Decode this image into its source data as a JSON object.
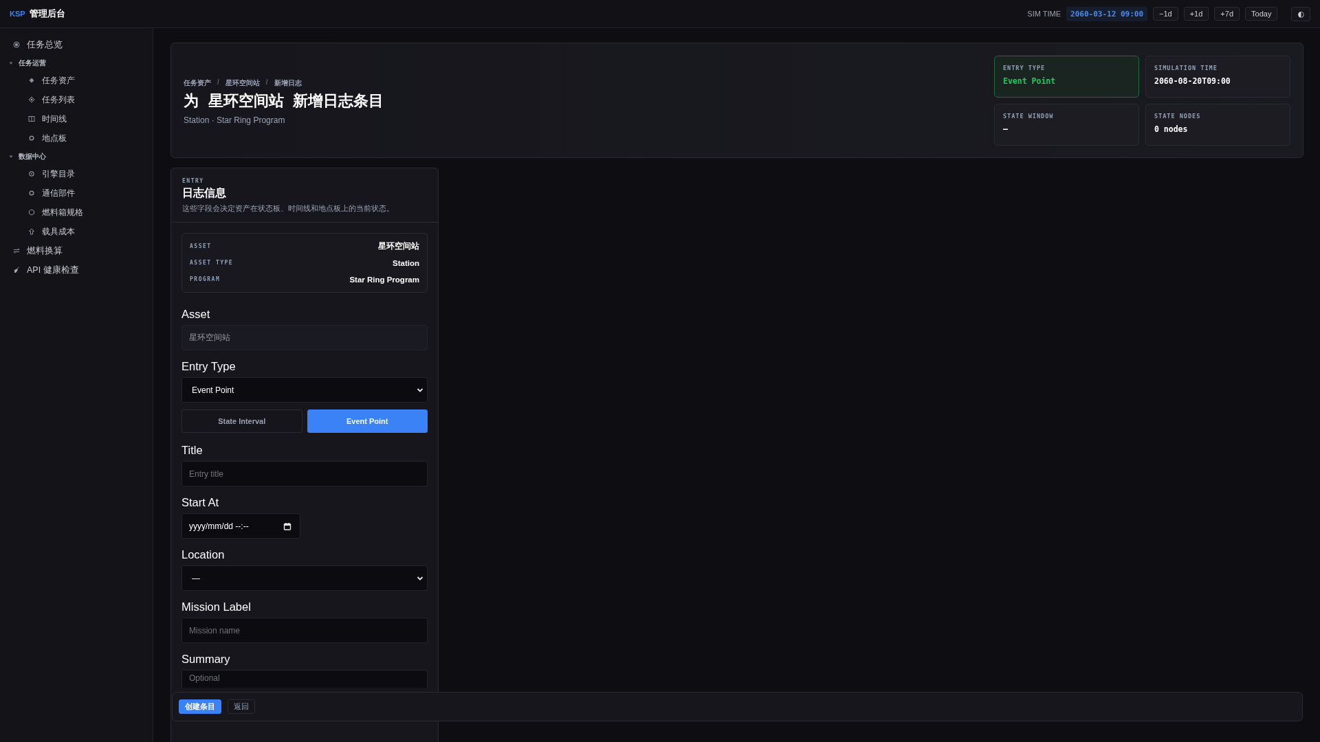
{
  "topbar": {
    "brand_mark": "KSP",
    "brand_title": "管理后台",
    "sim_time_label": "SIM TIME",
    "sim_time": "2060-03-12 09:00",
    "buttons": [
      "−1d",
      "+1d",
      "+7d",
      "Today"
    ],
    "theme_toggle": "◐"
  },
  "sidebar": {
    "items": [
      {
        "kind": "link",
        "label": "任务总览"
      },
      {
        "kind": "group",
        "label": "任务运营",
        "expanded": true,
        "children": [
          {
            "label": "任务资产"
          },
          {
            "label": "任务列表"
          },
          {
            "label": "时间线"
          },
          {
            "label": "地点板"
          }
        ]
      },
      {
        "kind": "group",
        "label": "数据中心",
        "expanded": true,
        "children": [
          {
            "label": "引擎目录"
          },
          {
            "label": "通信部件"
          },
          {
            "label": "燃料箱规格"
          },
          {
            "label": "载具成本"
          }
        ]
      },
      {
        "kind": "link",
        "label": "燃料换算"
      },
      {
        "kind": "link",
        "label": "API 健康检查"
      }
    ]
  },
  "header": {
    "breadcrumb": [
      "任务资产",
      "星环空间站",
      "新增日志"
    ],
    "breadcrumb_separators": [
      "/",
      "/"
    ],
    "title": "为 星环空间站 新增日志条目",
    "subtitle": "Station · Star Ring Program",
    "stats": [
      {
        "label": "ENTRY TYPE",
        "value": "Event Point",
        "highlighted": true
      },
      {
        "label": "SIMULATION TIME",
        "value": "2060-08-20T09:00",
        "highlighted": false
      },
      {
        "label": "STATE WINDOW",
        "value": "—",
        "highlighted": false
      },
      {
        "label": "STATE NODES",
        "value": "0 nodes",
        "highlighted": false
      }
    ]
  },
  "form": {
    "eyebrow": "ENTRY",
    "heading": "日志信息",
    "description": "这些字段会决定资产在状态板、时间线和地点板上的当前状态。",
    "summary": [
      {
        "label": "ASSET",
        "value": "星环空间站"
      },
      {
        "label": "ASSET TYPE",
        "value": "Station"
      },
      {
        "label": "PROGRAM",
        "value": "Star Ring Program"
      }
    ],
    "fields": [
      {
        "kind": "text",
        "label": "Asset",
        "value": "星环空间站",
        "disabled": true
      },
      {
        "kind": "select",
        "label": "Entry Type",
        "value": "Event Point"
      },
      {
        "kind": "segmented",
        "options": [
          {
            "label": "State Interval",
            "selected": false
          },
          {
            "label": "Event Point",
            "selected": true
          }
        ]
      },
      {
        "kind": "text",
        "label": "Title",
        "placeholder": "Entry title",
        "disabled": false
      },
      {
        "kind": "datetime",
        "label": "Start At",
        "value": "yyyy/mm/dd --:--"
      },
      {
        "kind": "select",
        "label": "Location",
        "value": "—"
      },
      {
        "kind": "text",
        "label": "Mission Label",
        "placeholder": "Mission name",
        "disabled": false
      },
      {
        "kind": "textarea",
        "label": "Summary",
        "placeholder": "Optional"
      }
    ]
  },
  "actions": [
    {
      "label": "创建条目",
      "primary": true
    },
    {
      "label": "返回",
      "primary": false
    }
  ]
}
